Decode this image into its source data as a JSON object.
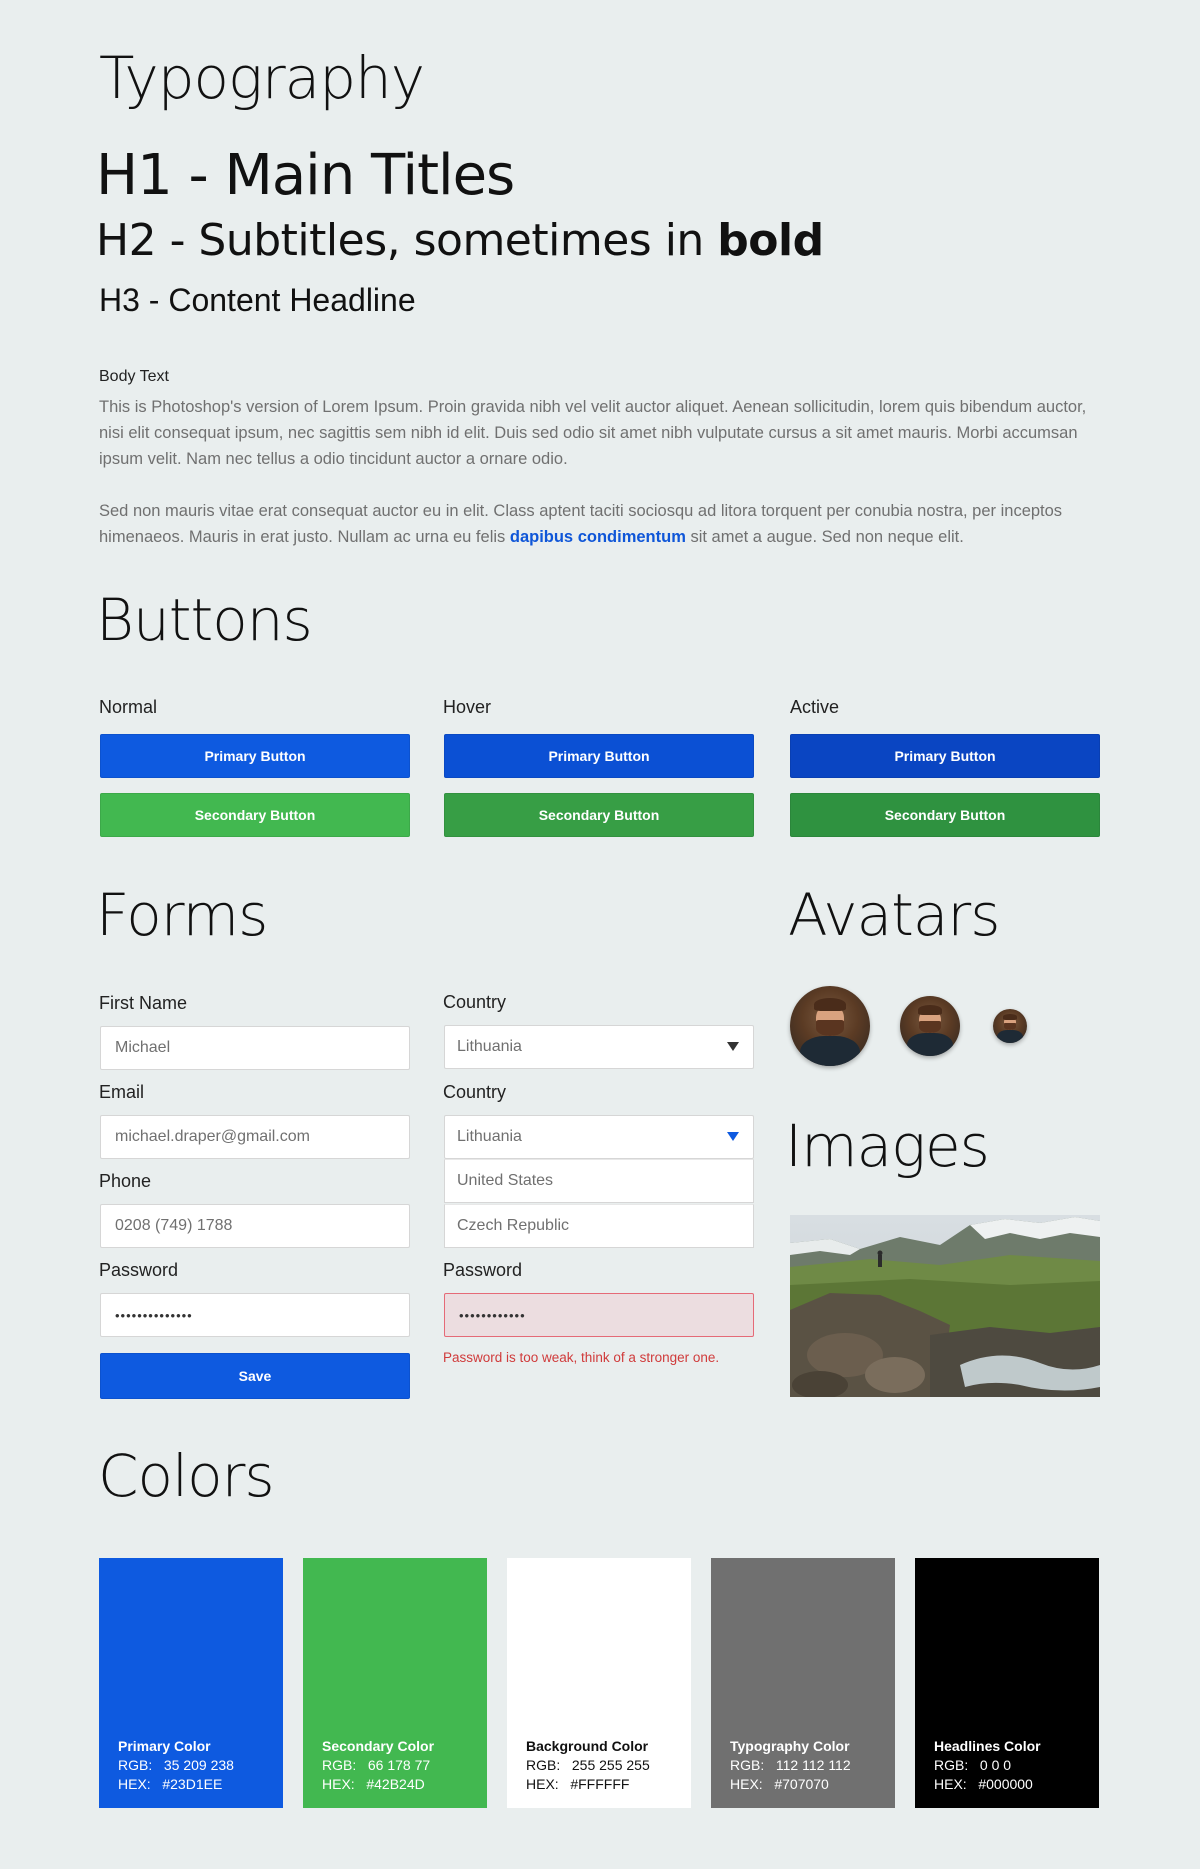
{
  "typography": {
    "title": "Typography",
    "h1": "H1 - Main Titles",
    "h2_prefix": "H2 - Subtitles, sometimes in ",
    "h2_bold": "bold",
    "h3": "H3 - Content Headline",
    "body_label": "Body Text",
    "para1": "This is Photoshop's version  of Lorem Ipsum. Proin gravida nibh vel velit auctor aliquet. Aenean sollicitudin, lorem quis bibendum auctor, nisi elit consequat ipsum, nec sagittis sem nibh id elit. Duis sed odio sit amet nibh vulputate cursus a sit amet mauris. Morbi accumsan ipsum velit. Nam nec tellus a odio tincidunt auctor a ornare odio.",
    "para2_before": "Sed non  mauris vitae erat consequat auctor eu in elit. Class aptent taciti sociosqu ad litora torquent per conubia nostra, per inceptos himenaeos. Mauris in erat justo. Nullam ac urna eu felis ",
    "para2_link": "dapibus condimentum",
    "para2_after": " sit amet a augue. Sed non neque elit."
  },
  "buttons": {
    "title": "Buttons",
    "states": [
      "Normal",
      "Hover",
      "Active"
    ],
    "primary_label": "Primary Button",
    "secondary_label": "Secondary Button"
  },
  "forms": {
    "title": "Forms",
    "first_name_label": "First Name",
    "first_name_value": "Michael",
    "email_label": "Email",
    "email_value": "michael.draper@gmail.com",
    "phone_label": "Phone",
    "phone_value": "0208 (749) 1788",
    "password_label": "Password",
    "password_value": "••••••••••••••",
    "save_label": "Save",
    "country_label": "Country",
    "country_value": "Lithuania",
    "country2_label": "Country",
    "country2_value": "Lithuania",
    "country_options": [
      "United States",
      "Czech Republic"
    ],
    "password2_label": "Password",
    "password2_value": "••••••••••••",
    "password_error": "Password is too weak, think of a stronger one."
  },
  "avatars": {
    "title": "Avatars"
  },
  "images": {
    "title": "Images"
  },
  "colors": {
    "title": "Colors",
    "swatches": [
      {
        "name": "Primary Color",
        "rgb": "RGB:   35 209 238",
        "hex": "HEX:   #23D1EE",
        "fill": "#0E5AE0",
        "text": "#FFFFFF"
      },
      {
        "name": "Secondary Color",
        "rgb": "RGB:   66 178 77",
        "hex": "HEX:   #42B24D",
        "fill": "#42B850",
        "text": "#FFFFFF"
      },
      {
        "name": "Background Color",
        "rgb": "RGB:   255 255 255",
        "hex": "HEX:   #FFFFFF",
        "fill": "#FFFFFF",
        "text": "#111111"
      },
      {
        "name": "Typography Color",
        "rgb": "RGB:   112 112 112",
        "hex": "HEX:   #707070",
        "fill": "#707070",
        "text": "#FFFFFF"
      },
      {
        "name": "Headlines Color",
        "rgb": "RGB:   0 0 0",
        "hex": "HEX:   #000000",
        "fill": "#000000",
        "text": "#FFFFFF"
      }
    ]
  }
}
